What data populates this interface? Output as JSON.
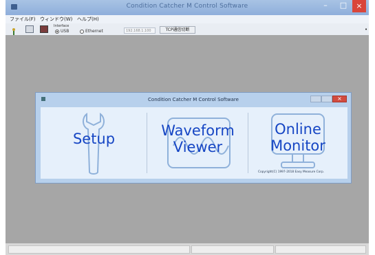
{
  "window": {
    "title": "Condition Catcher M  Control Software",
    "controls": {
      "minimize": "–",
      "maximize": "□",
      "close": "×"
    }
  },
  "menu": [
    {
      "label": "ファイル(F)"
    },
    {
      "label": "ウィンドウ(W)"
    },
    {
      "label": "ヘルプ(H)"
    }
  ],
  "toolbar": {
    "icons": [
      "tool-icon",
      "panel-icon",
      "save-icon"
    ],
    "interface_label": "Interface",
    "usb_label": "USB",
    "ethernet_label": "Ethernet",
    "usb_selected": true,
    "ip_value": "192.168.1.100",
    "command_button_label": "TCP通信切断",
    "end_marker": "•"
  },
  "launcher": {
    "title": "Condition Catcher M  Control Software",
    "tiles": [
      {
        "line1": "Setup",
        "line2": "",
        "icon": "wrench-icon"
      },
      {
        "line1": "Waveform",
        "line2": "Viewer",
        "icon": "waveform-icon"
      },
      {
        "line1": "Online",
        "line2": "Monitor",
        "icon": "monitor-icon"
      }
    ],
    "copyright": "Copyright(C) 1997-2018 Easy Measure Corp."
  },
  "colors": {
    "accent": "#1646c4",
    "titlebar": "#8eaedb",
    "workspace": "#a6a6a6",
    "close": "#d24b3f"
  }
}
